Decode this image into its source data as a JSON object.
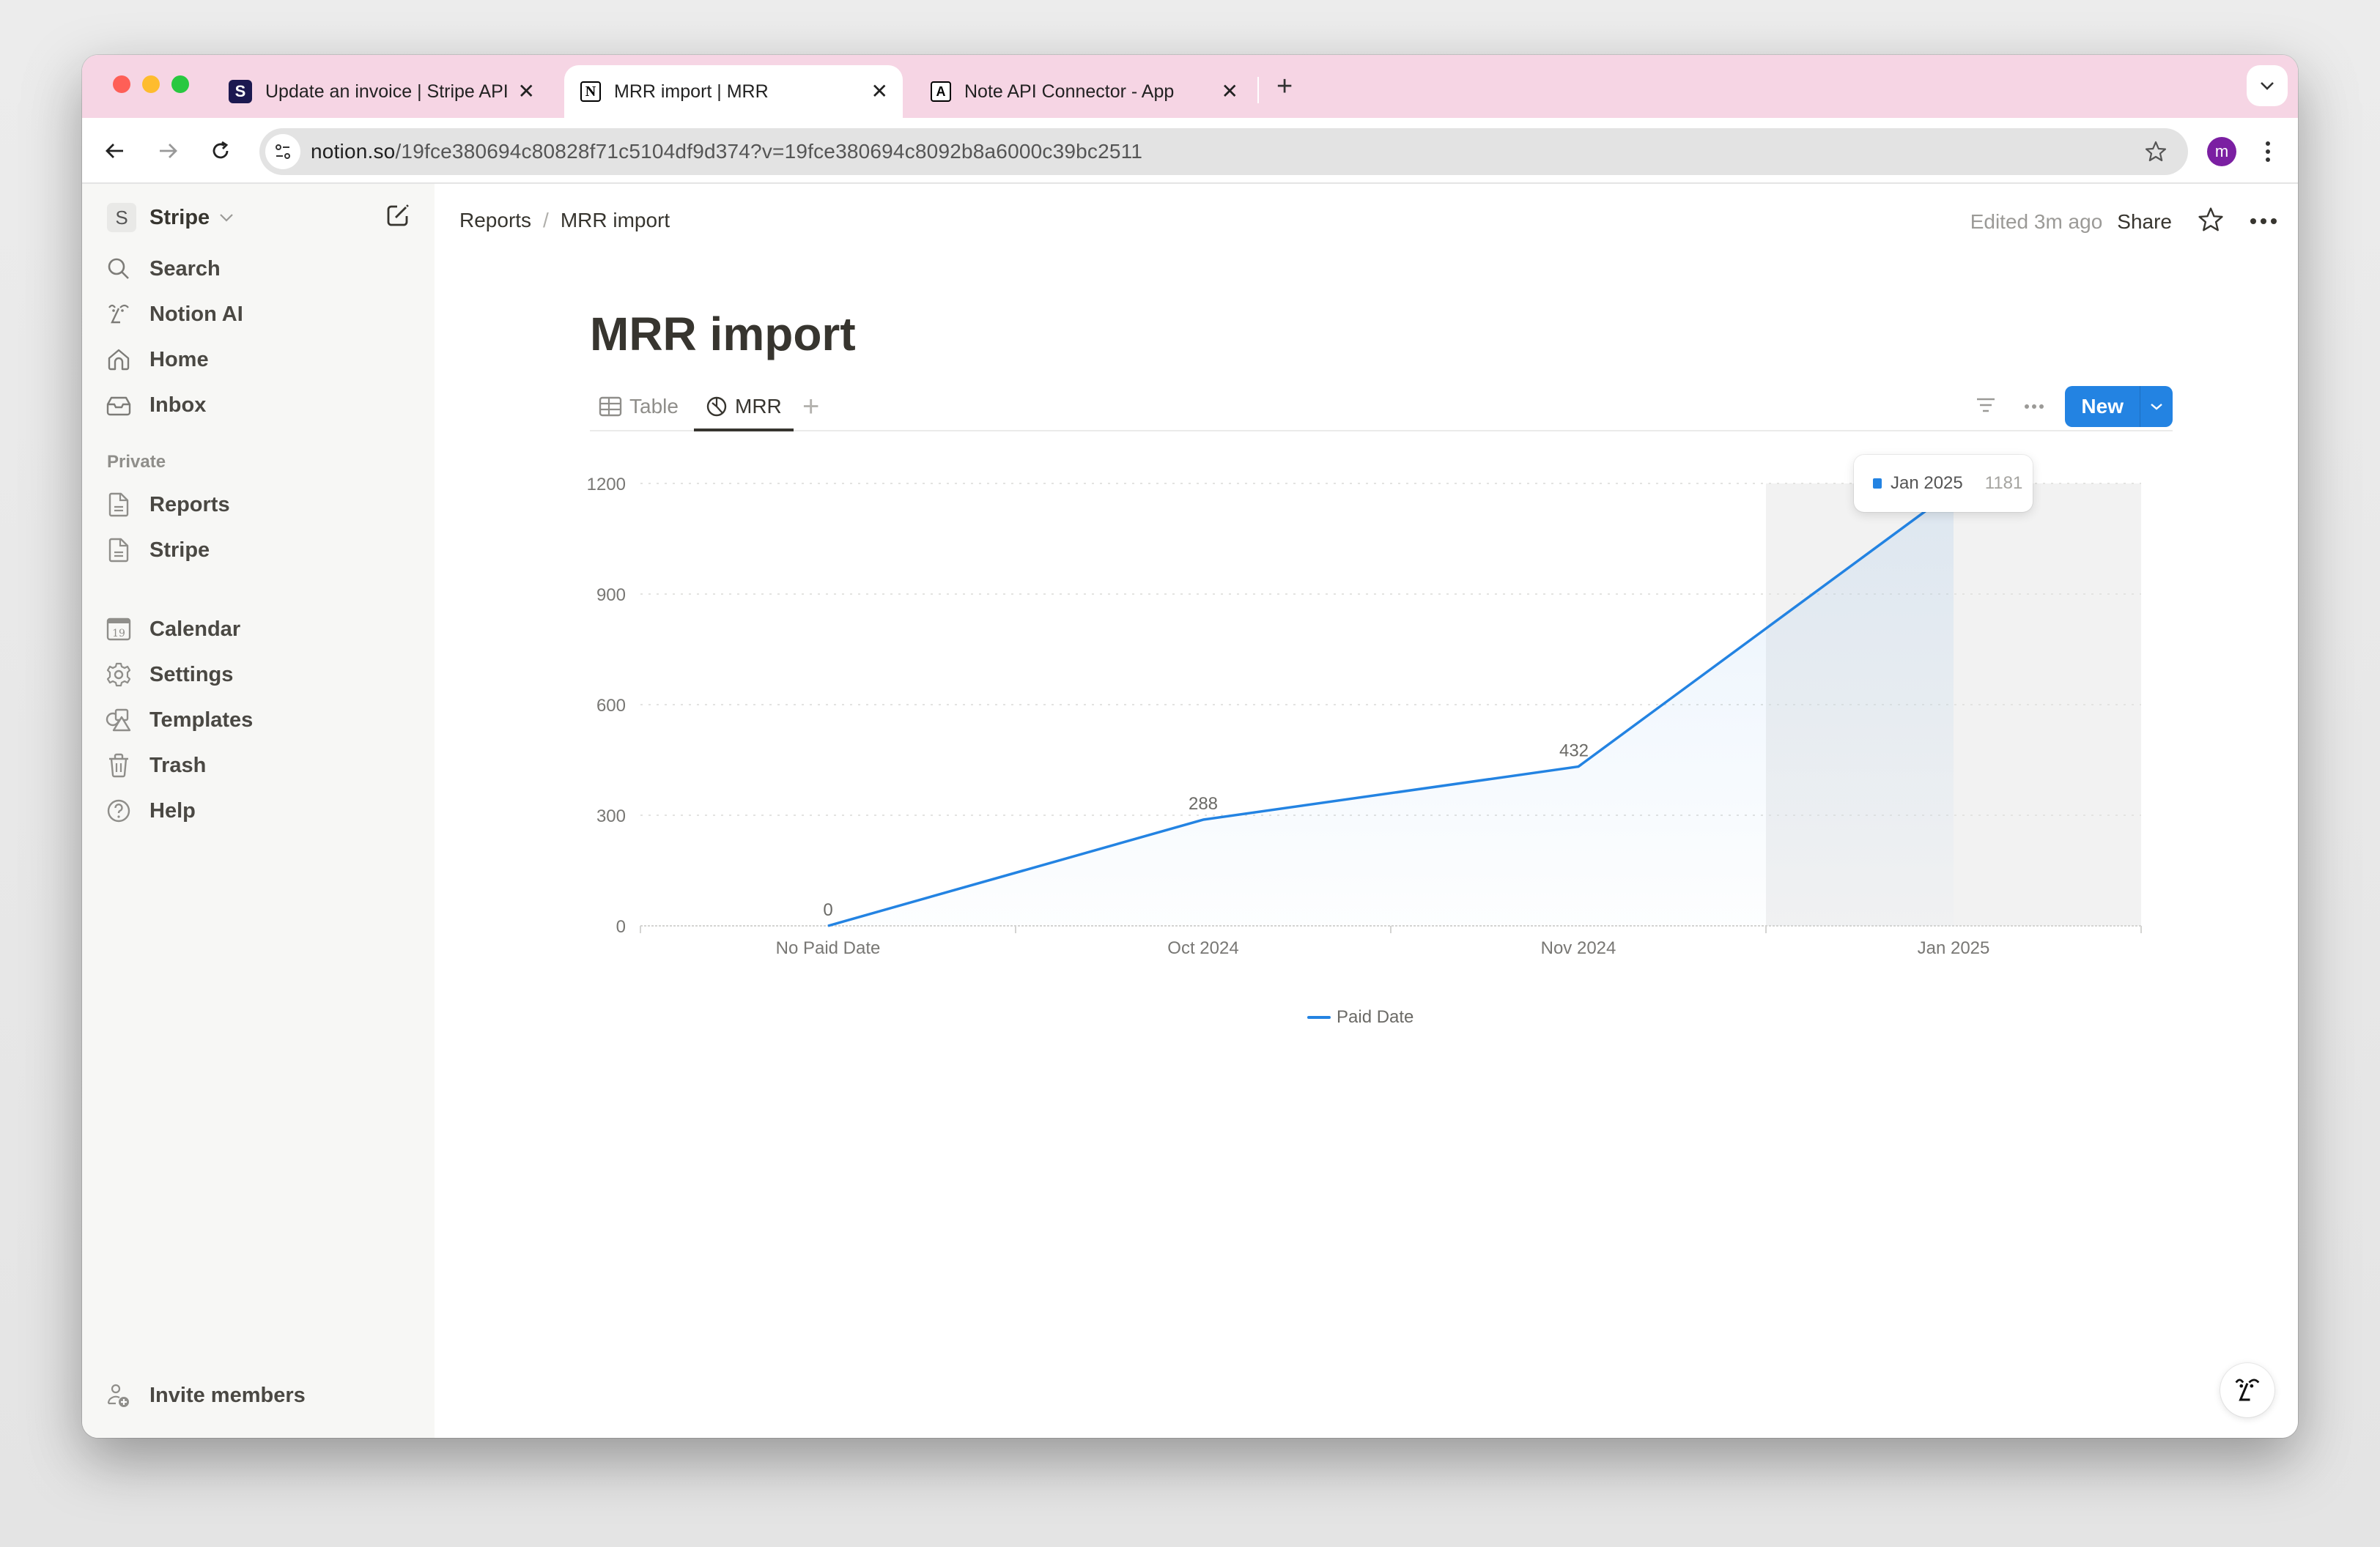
{
  "browser": {
    "tabs": [
      {
        "title": "Update an invoice | Stripe API",
        "favicon": "S",
        "active": false
      },
      {
        "title": "MRR import | MRR",
        "favicon": "N",
        "active": true
      },
      {
        "title": "Note API Connector - App",
        "favicon": "A",
        "active": false
      }
    ],
    "url_host": "notion.so",
    "url_path": "/19fce380694c80828f71c5104df9d374?v=19fce380694c8092b8a6000c39bc2511",
    "profile_initial": "m",
    "colors": {
      "tabbar": "#f6d5e4",
      "profile": "#7b1fa2"
    }
  },
  "sidebar": {
    "workspace_initial": "S",
    "workspace_name": "Stripe",
    "top_items": [
      {
        "label": "Search",
        "icon": "search-icon"
      },
      {
        "label": "Notion AI",
        "icon": "notion-ai-icon"
      },
      {
        "label": "Home",
        "icon": "home-icon"
      },
      {
        "label": "Inbox",
        "icon": "inbox-icon"
      }
    ],
    "section_label": "Private",
    "private_items": [
      {
        "label": "Reports",
        "icon": "page-icon"
      },
      {
        "label": "Stripe",
        "icon": "page-icon"
      }
    ],
    "bottom_items": [
      {
        "label": "Calendar",
        "icon": "calendar-icon",
        "icon_text": "19"
      },
      {
        "label": "Settings",
        "icon": "gear-icon"
      },
      {
        "label": "Templates",
        "icon": "templates-icon"
      },
      {
        "label": "Trash",
        "icon": "trash-icon"
      },
      {
        "label": "Help",
        "icon": "help-icon"
      }
    ],
    "invite_label": "Invite members"
  },
  "header": {
    "breadcrumb": [
      "Reports",
      "MRR import"
    ],
    "edited": "Edited 3m ago",
    "share": "Share"
  },
  "page": {
    "title": "MRR import",
    "views": [
      {
        "label": "Table",
        "icon": "table-icon",
        "active": false
      },
      {
        "label": "MRR",
        "icon": "chart-icon",
        "active": true
      }
    ],
    "new_button": "New",
    "accent": "#2383e2"
  },
  "chart_data": {
    "type": "area",
    "title": "",
    "xlabel": "",
    "ylabel": "",
    "categories": [
      "No Paid Date",
      "Oct 2024",
      "Nov 2024",
      "Jan 2025"
    ],
    "series": [
      {
        "name": "Paid Date",
        "values": [
          0,
          288,
          432,
          1181
        ],
        "color": "#2383e2"
      }
    ],
    "y_ticks": [
      0,
      300,
      600,
      900,
      1200
    ],
    "ylim": [
      0,
      1200
    ],
    "grid": true,
    "data_labels": true,
    "legend": "bottom-center",
    "highlighted_category": "Jan 2025",
    "tooltip": {
      "label": "Jan 2025",
      "value": "1181"
    }
  }
}
